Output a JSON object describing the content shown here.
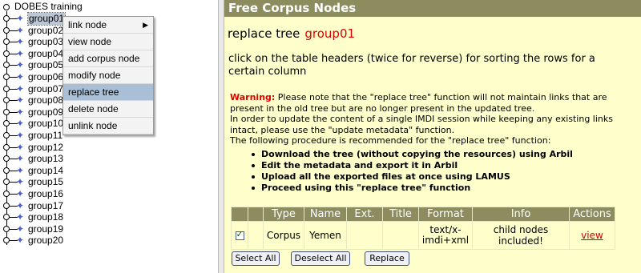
{
  "tree": {
    "root_label": "DOBES training",
    "selected_index": 0,
    "groups": [
      "group01",
      "group02",
      "group03",
      "group04",
      "group05",
      "group06",
      "group07",
      "group08",
      "group09",
      "group10",
      "group11",
      "group12",
      "group13",
      "group14",
      "group15",
      "group16",
      "group17",
      "group18",
      "group19",
      "group20"
    ]
  },
  "context_menu": {
    "items": [
      {
        "label": "link node",
        "submenu": true
      },
      {
        "label": "view node"
      },
      {
        "label": "add corpus node"
      },
      {
        "label": "modify node"
      },
      {
        "label": "replace tree",
        "highlighted": true
      },
      {
        "label": "delete node"
      },
      {
        "label": "unlink node"
      }
    ]
  },
  "main": {
    "header_title": "Free Corpus Nodes",
    "title_prefix": "replace tree",
    "title_group": "group01",
    "instruction": "click on the table headers (twice for reverse) for sorting the rows for a certain column",
    "warning_label": "Warning:",
    "warning_text": " Please note that the \"replace tree\" function will not maintain links that are present in the old tree but are no longer present in the updated tree.",
    "warning_line2": "In order to update the content of a single IMDI session while keeping any existing links intact, please use the \"update metadata\" function.",
    "warning_line3": "The following procedure is recommended for the \"replace tree\" function:",
    "steps": [
      "Download the tree (without copying the resources) using Arbil",
      "Edit the metadata and export it in Arbil",
      "Upload all the exported files at once using LAMUS",
      "Proceed using this \"replace tree\" function"
    ],
    "table": {
      "headers": [
        "",
        "",
        "Type",
        "Name",
        "Ext.",
        "Title",
        "Format",
        "Info",
        "Actions"
      ],
      "rows": [
        {
          "checked": true,
          "type": "Corpus",
          "name": "Yemen",
          "ext": "",
          "title": "",
          "format": "text/x-imdi+xml",
          "info": "child nodes included!",
          "action": "view"
        }
      ]
    },
    "buttons": {
      "select_all": "Select All",
      "deselect_all": "Deselect All",
      "replace": "Replace"
    }
  },
  "colors": {
    "header_bg": "#8c8c5f",
    "panel_bg": "#ffffcc",
    "accent_red": "#dd0000",
    "tree_icon": "#4a5ec9",
    "menu_highlight": "#a9bfd5"
  }
}
